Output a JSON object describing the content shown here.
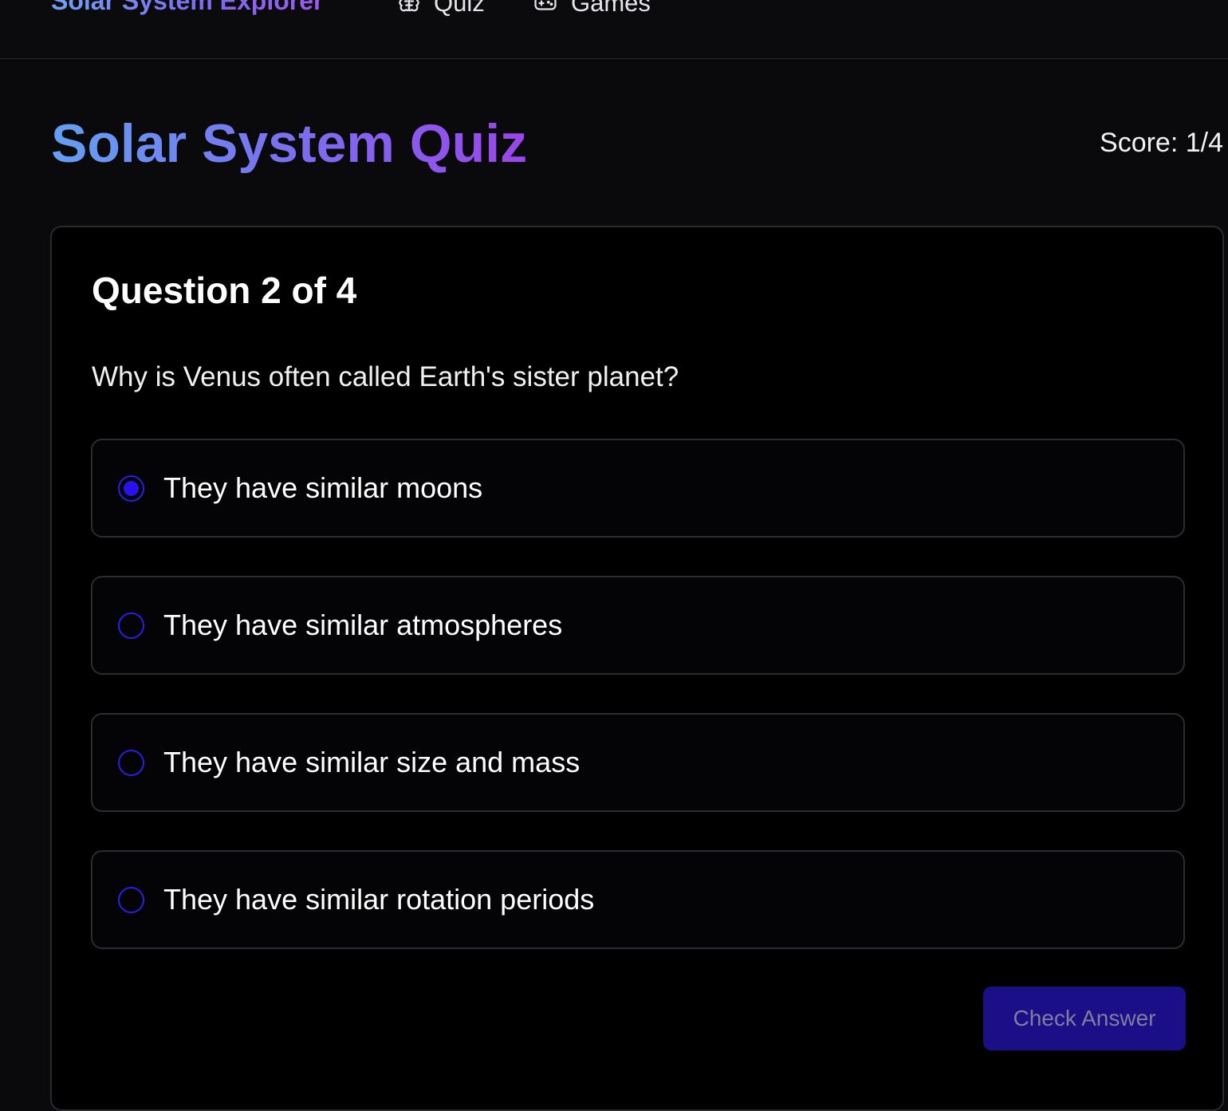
{
  "nav": {
    "brand": "Solar System Explorer",
    "items": [
      {
        "label": "Quiz",
        "icon": "brain-icon"
      },
      {
        "label": "Games",
        "icon": "gamepad-icon"
      }
    ]
  },
  "page": {
    "title": "Solar System Quiz",
    "score": "Score: 1/4"
  },
  "question": {
    "heading": "Question 2 of 4",
    "text": "Why is Venus often called Earth's sister planet?",
    "options": [
      {
        "label": "They have similar moons",
        "selected": true
      },
      {
        "label": "They have similar atmospheres",
        "selected": false
      },
      {
        "label": "They have similar size and mass",
        "selected": false
      },
      {
        "label": "They have similar rotation periods",
        "selected": false
      }
    ],
    "submit_label": "Check Answer"
  },
  "colors": {
    "background": "#0a0a0d",
    "card": "#000000",
    "accent": "#2a10ee",
    "button": "#1a0f86",
    "brand_gradient_start": "#63a0f2",
    "brand_gradient_end": "#9a45ea"
  }
}
